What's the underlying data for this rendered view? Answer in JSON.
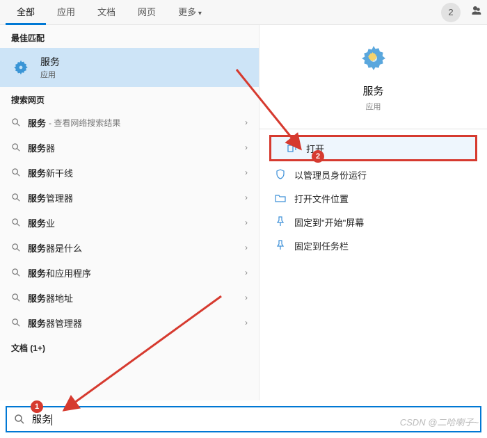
{
  "tabs": {
    "all": "全部",
    "apps": "应用",
    "docs": "文档",
    "web": "网页",
    "more": "更多"
  },
  "header": {
    "avatar_initial": "2"
  },
  "left": {
    "best_match_header": "最佳匹配",
    "best_match": {
      "title": "服务",
      "subtitle": "应用"
    },
    "web_header": "搜索网页",
    "web_items": [
      {
        "label": "服务",
        "suffix": "- 查看网络搜索结果"
      },
      {
        "label": "服务器",
        "suffix": ""
      },
      {
        "label": "服务新干线",
        "suffix": ""
      },
      {
        "label": "服务管理器",
        "suffix": ""
      },
      {
        "label": "服务业",
        "suffix": ""
      },
      {
        "label": "服务器是什么",
        "suffix": ""
      },
      {
        "label": "服务和应用程序",
        "suffix": ""
      },
      {
        "label": "服务器地址",
        "suffix": ""
      },
      {
        "label": "服务器管理器",
        "suffix": ""
      }
    ],
    "docs_header": "文档 (1+)"
  },
  "right": {
    "title": "服务",
    "subtitle": "应用",
    "actions": {
      "open": "打开",
      "run_admin": "以管理员身份运行",
      "open_location": "打开文件位置",
      "pin_start": "固定到\"开始\"屏幕",
      "pin_taskbar": "固定到任务栏"
    }
  },
  "search": {
    "value": "服务"
  },
  "watermark": "CSDN @二哈喇子~",
  "annotations": {
    "badge1": "1",
    "badge2": "2"
  }
}
